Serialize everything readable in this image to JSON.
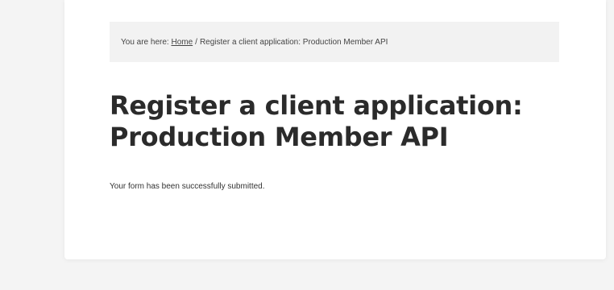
{
  "breadcrumb": {
    "prefix": "You are here:",
    "home_label": "Home",
    "separator": "/",
    "current": "Register a client application: Production Member API"
  },
  "page": {
    "title": "Register a client application: Production Member API",
    "message": "Your form has been successfully submitted."
  }
}
